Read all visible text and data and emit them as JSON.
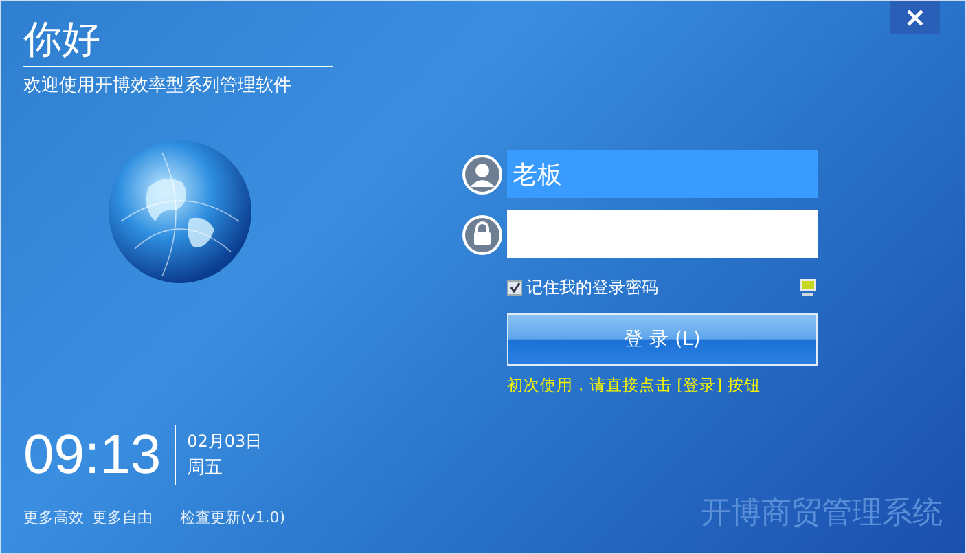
{
  "header": {
    "title": "你好",
    "subtitle": "欢迎使用开博效率型系列管理软件"
  },
  "login": {
    "username": "老板",
    "remember": {
      "label": "记住我的登录密码",
      "checked": true
    },
    "button": "登  录 (L)",
    "hint": "初次使用，请直接点击 [登录] 按钮"
  },
  "clock": {
    "time": "09:13",
    "date": "02月03日",
    "weekday": "周五"
  },
  "links": [
    "更多高效",
    "更多自由",
    "检查更新(v1.0)"
  ],
  "brand": "开博商贸管理系统"
}
